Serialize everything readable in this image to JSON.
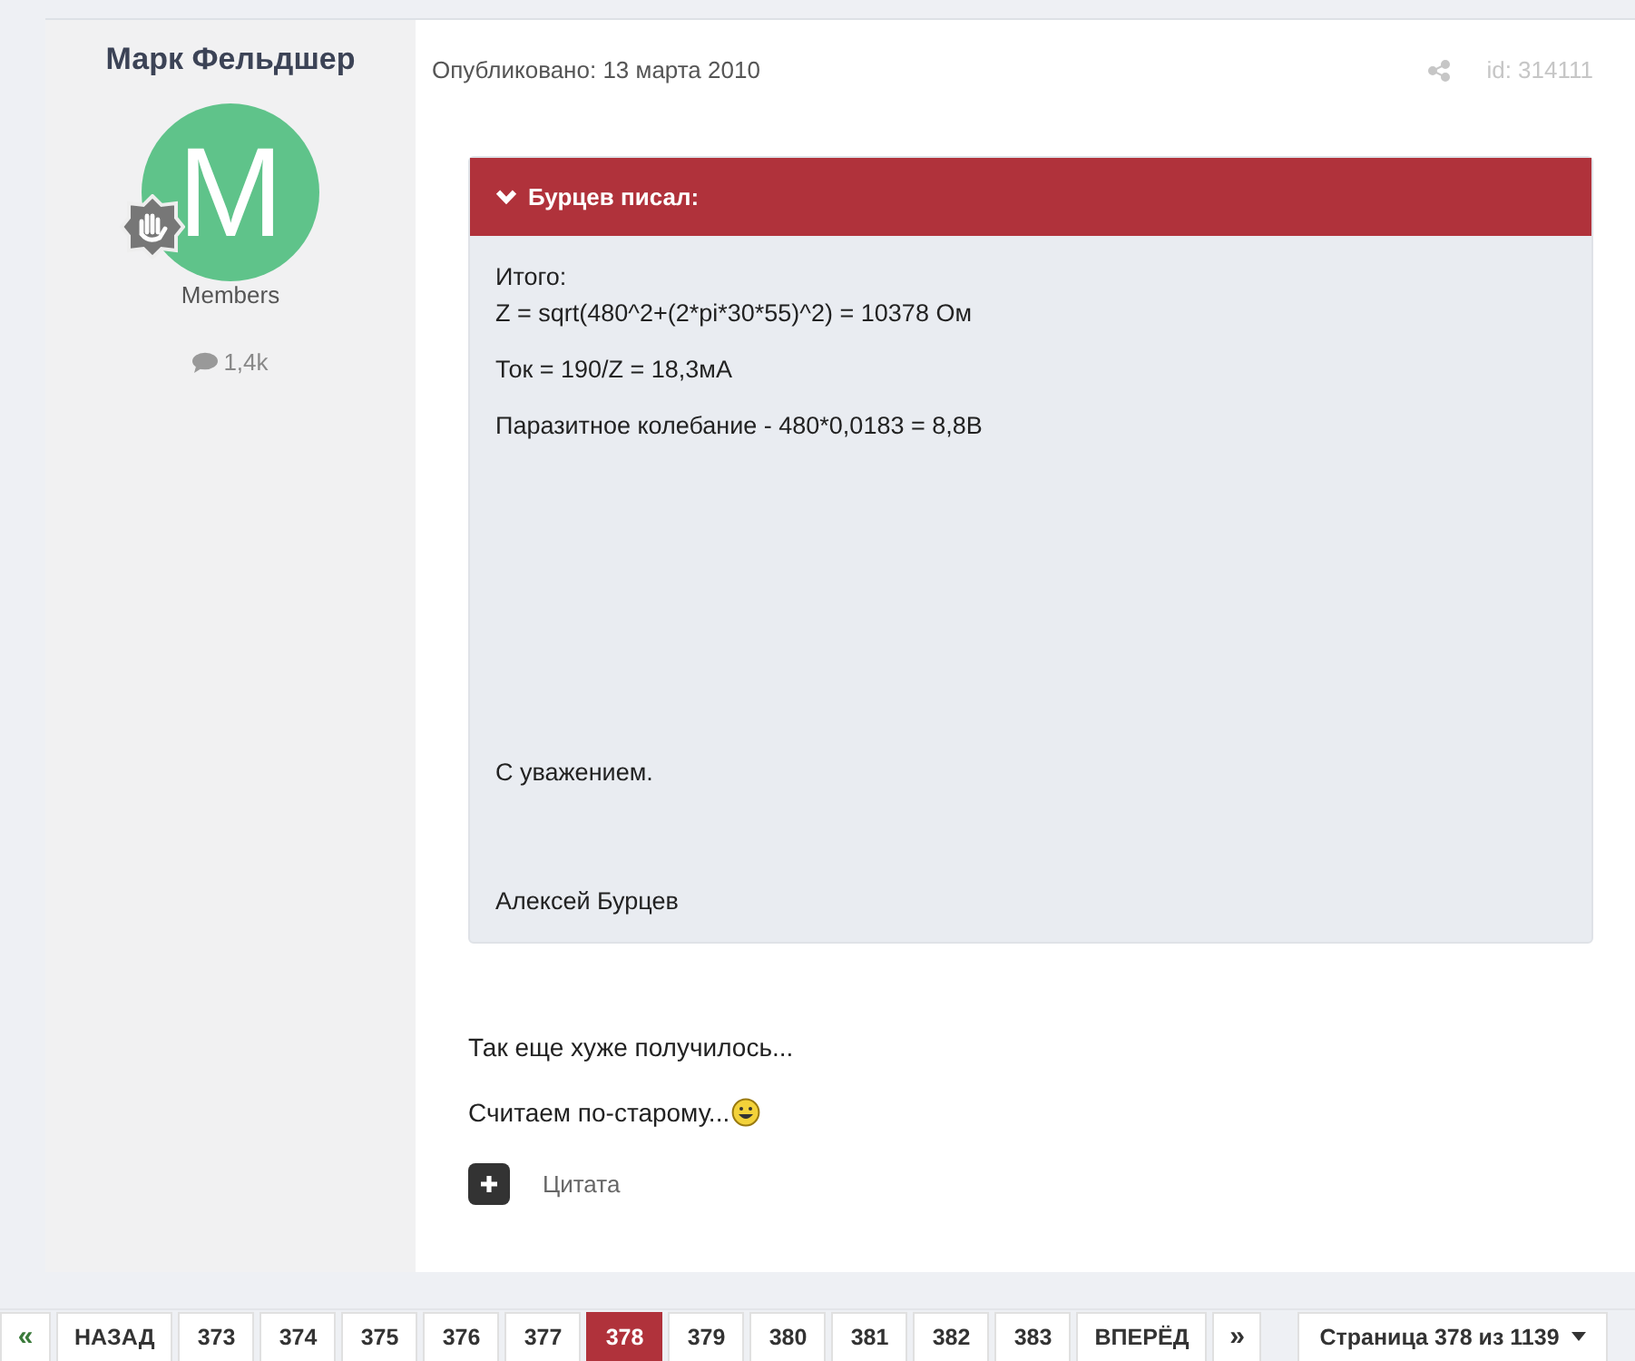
{
  "author": {
    "name": "Марк Фельдшер",
    "avatar_letter": "M",
    "group": "Members",
    "posts": "1,4k"
  },
  "post": {
    "published": "Опубликовано: 13 марта 2010",
    "id": "id: 314111",
    "quote": {
      "author": "Бурцев писал:",
      "expanded": true,
      "paragraphs": [
        [
          "Итого:",
          "Z = sqrt(480^2+(2*pi*30*55)^2) = 10378 Ом"
        ],
        [
          "Ток = 190/Z = 18,3мА"
        ],
        [
          "Паразитное колебание - 480*0,0183 = 8,8В"
        ]
      ],
      "signature": [
        "С уважением.",
        "Алексей Бурцев"
      ]
    },
    "paragraphs": [
      "Так еще хуже получилось...",
      "Считаем по-старому..."
    ],
    "quote_label": "Цитата"
  },
  "pagination": {
    "first": "«",
    "prev": "НАЗАД",
    "pages": [
      {
        "label": "373",
        "selected": false
      },
      {
        "label": "374",
        "selected": false
      },
      {
        "label": "375",
        "selected": false
      },
      {
        "label": "376",
        "selected": false
      },
      {
        "label": "377",
        "selected": false
      },
      {
        "label": "378",
        "selected": true
      },
      {
        "label": "379",
        "selected": false
      },
      {
        "label": "380",
        "selected": false
      },
      {
        "label": "381",
        "selected": false
      },
      {
        "label": "382",
        "selected": false
      },
      {
        "label": "383",
        "selected": false
      }
    ],
    "next": "ВПЕРЁД",
    "last": "»",
    "jump": "Страница 378 из 1139"
  }
}
